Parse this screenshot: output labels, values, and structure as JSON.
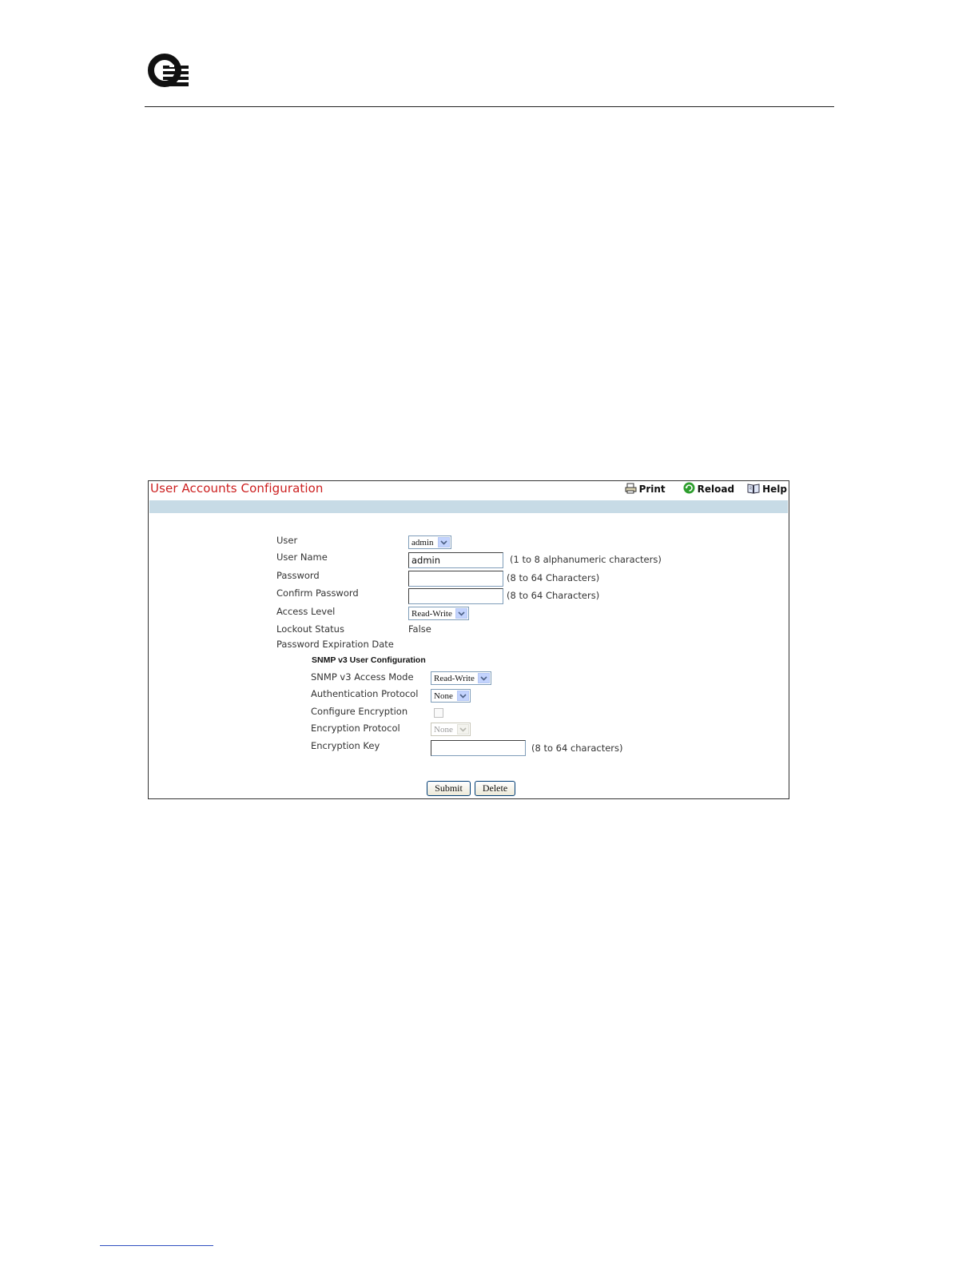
{
  "panel": {
    "title": "User Accounts Configuration",
    "toolbar": {
      "print": "Print",
      "reload": "Reload",
      "help": "Help"
    }
  },
  "form": {
    "user": {
      "label": "User",
      "value": "admin"
    },
    "user_name": {
      "label": "User Name",
      "value": "admin",
      "hint": "(1 to 8 alphanumeric characters)"
    },
    "password": {
      "label": "Password",
      "value": "",
      "hint": "(8 to 64 Characters)"
    },
    "confirm_password": {
      "label": "Confirm Password",
      "value": "",
      "hint": "(8 to 64 Characters)"
    },
    "access_level": {
      "label": "Access Level",
      "value": "Read-Write"
    },
    "lockout_status": {
      "label": "Lockout Status",
      "value": "False"
    },
    "password_expiration": {
      "label": "Password Expiration Date",
      "value": ""
    }
  },
  "snmp": {
    "heading": "SNMP v3 User Configuration",
    "access_mode": {
      "label": "SNMP v3 Access Mode",
      "value": "Read-Write"
    },
    "auth_protocol": {
      "label": "Authentication Protocol",
      "value": "None"
    },
    "configure_encryption": {
      "label": "Configure Encryption",
      "checked": false
    },
    "encryption_protocol": {
      "label": "Encryption Protocol",
      "value": "None",
      "disabled": true
    },
    "encryption_key": {
      "label": "Encryption Key",
      "value": "",
      "hint": "(8 to 64 characters)"
    }
  },
  "buttons": {
    "submit": "Submit",
    "delete": "Delete"
  }
}
